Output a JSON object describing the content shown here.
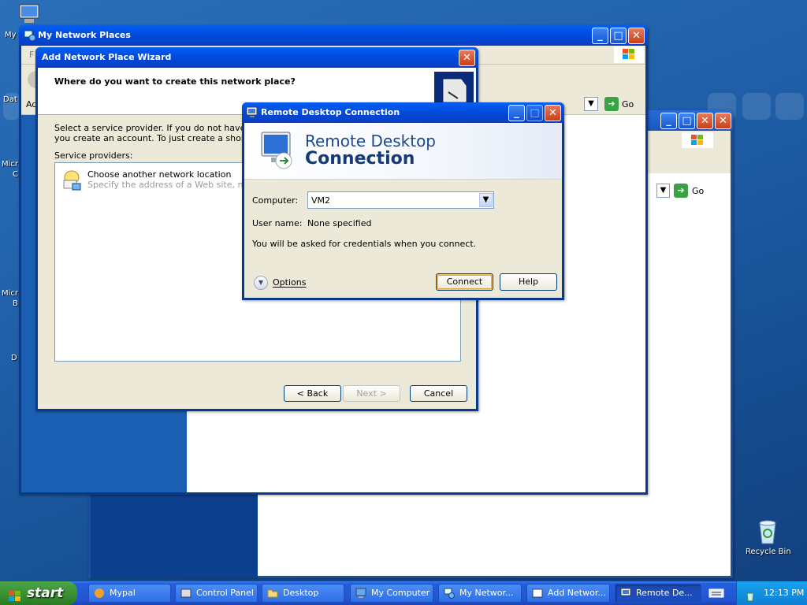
{
  "desktop": {
    "icons": [
      {
        "label": "My"
      },
      {
        "label": "Dat"
      },
      {
        "label": "Micr"
      },
      {
        "label": "C"
      },
      {
        "label": "Micr"
      },
      {
        "label": "B"
      },
      {
        "label": "D"
      },
      {
        "label": "Recycle Bin"
      }
    ]
  },
  "network_places_window": {
    "title": "My Network Places",
    "address_prefix": "Ad",
    "go_label": "Go",
    "menu_stub": "F"
  },
  "background_window2": {
    "go_label": "Go"
  },
  "wizard": {
    "title": "Add Network Place Wizard",
    "heading": "Where do you want to create this network place?",
    "intro_line1": "Select a service provider.  If you do not have a me",
    "intro_line2": "you create an account.  To just create a shortcut,",
    "providers_label": "Service providers:",
    "provider_name": "Choose another network location",
    "provider_desc": "Specify the address of a Web site, netwo",
    "back_label": "< Back",
    "next_label": "Next >",
    "cancel_label": "Cancel"
  },
  "rdc": {
    "title": "Remote Desktop Connection",
    "banner_line1": "Remote Desktop",
    "banner_line2": "Connection",
    "computer_label": "Computer:",
    "computer_value": "VM2",
    "username_label": "User name:",
    "username_value": "None specified",
    "credentials_note": "You will be asked for credentials when you connect.",
    "options_label": "Options",
    "connect_label": "Connect",
    "help_label": "Help"
  },
  "taskbar": {
    "start_label": "start",
    "tasks": [
      {
        "label": "Mypal"
      },
      {
        "label": "Control Panel"
      },
      {
        "label": "Desktop"
      },
      {
        "label": "My Computer"
      },
      {
        "label": "My Networ..."
      },
      {
        "label": "Add Networ..."
      },
      {
        "label": "Remote De..."
      }
    ],
    "clock": "12:13 PM"
  },
  "colors": {
    "titlebar_active": "#0347d6",
    "window_face": "#ece9d8",
    "desktop": "#1f5fa8",
    "start_green": "#378e2f"
  }
}
